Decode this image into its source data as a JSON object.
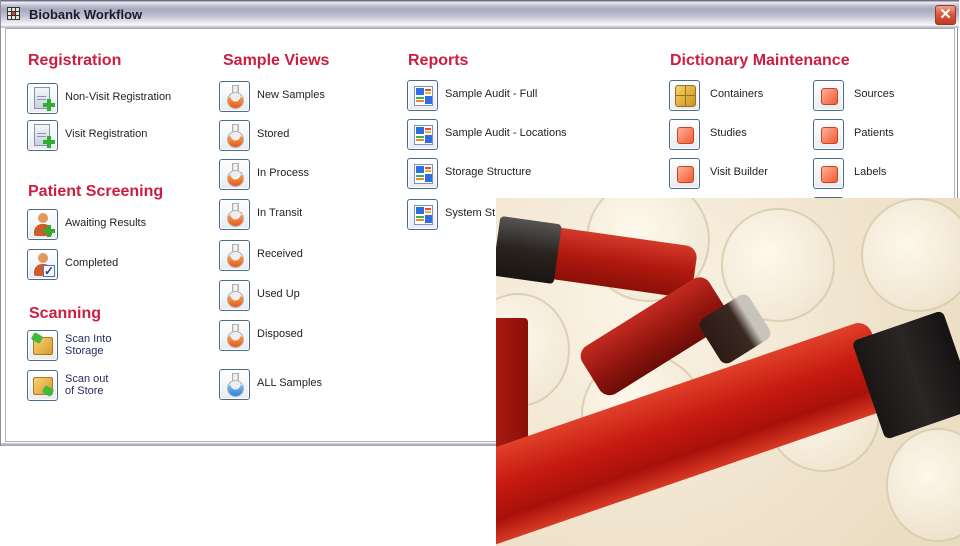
{
  "window": {
    "title": "Biobank Workflow",
    "close_label": "✕"
  },
  "sections": {
    "registration": {
      "title": "Registration",
      "items": [
        {
          "label": "Non-Visit Registration",
          "icon": "document-add-icon"
        },
        {
          "label": "Visit Registration",
          "icon": "document-add-icon"
        }
      ]
    },
    "patient_screening": {
      "title": "Patient Screening",
      "items": [
        {
          "label": "Awaiting Results",
          "icon": "person-add-icon"
        },
        {
          "label": "Completed",
          "icon": "person-check-icon"
        }
      ]
    },
    "scanning": {
      "title": "Scanning",
      "items": [
        {
          "label_line1": "Scan Into",
          "label_line2": "Storage",
          "icon": "box-in-icon"
        },
        {
          "label_line1": "Scan out",
          "label_line2": "of Store",
          "icon": "box-out-icon"
        }
      ]
    },
    "sample_views": {
      "title": "Sample Views",
      "items": [
        {
          "label": "New Samples",
          "icon": "flask-orange-icon"
        },
        {
          "label": "Stored",
          "icon": "flask-orange-icon"
        },
        {
          "label": "In Process",
          "icon": "flask-orange-icon"
        },
        {
          "label": "In Transit",
          "icon": "flask-orange-icon"
        },
        {
          "label": "Received",
          "icon": "flask-orange-icon"
        },
        {
          "label": "Used Up",
          "icon": "flask-orange-icon"
        },
        {
          "label": "Disposed",
          "icon": "flask-orange-icon"
        },
        {
          "label": "ALL Samples",
          "icon": "flask-blue-icon"
        }
      ]
    },
    "reports": {
      "title": "Reports",
      "items": [
        {
          "label": "Sample Audit - Full",
          "icon": "report-icon"
        },
        {
          "label": "Sample Audit - Locations",
          "icon": "report-icon"
        },
        {
          "label": "Storage Structure",
          "icon": "report-icon"
        },
        {
          "label": "System St",
          "icon": "report-icon"
        }
      ]
    },
    "dictionary": {
      "title": "Dictionary Maintenance",
      "items": [
        {
          "label": "Containers",
          "icon": "cube-icon"
        },
        {
          "label": "Studies",
          "icon": "square-icon"
        },
        {
          "label": "Visit Builder",
          "icon": "square-icon"
        },
        {
          "label": "Sources",
          "icon": "square-icon"
        },
        {
          "label": "Patients",
          "icon": "square-icon"
        },
        {
          "label": "Labels",
          "icon": "square-icon"
        }
      ]
    }
  },
  "colors": {
    "section_title": "#cc1e40",
    "icon_border": "#4b6b8e",
    "scan_label": "#2a2a66"
  },
  "overlay_image": {
    "description": "blood sample tubes photo"
  }
}
